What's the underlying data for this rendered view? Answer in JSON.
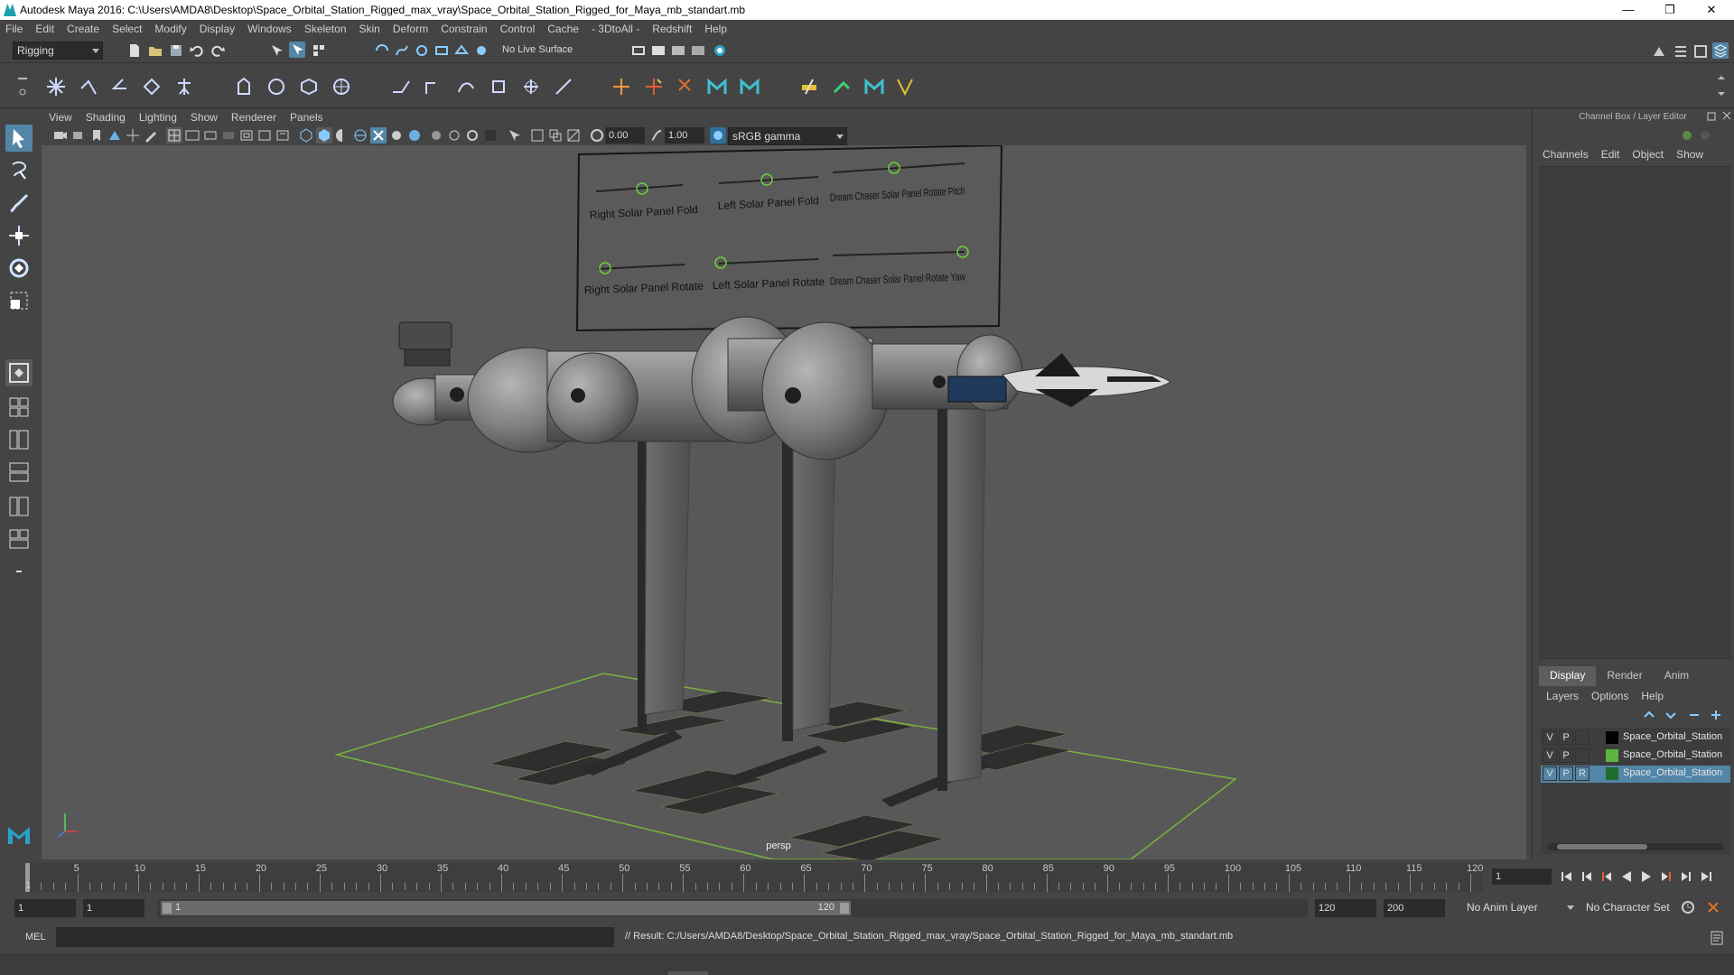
{
  "titlebar": {
    "title": "Autodesk Maya 2016: C:\\Users\\AMDA8\\Desktop\\Space_Orbital_Station_Rigged_max_vray\\Space_Orbital_Station_Rigged_for_Maya_mb_standart.mb"
  },
  "menubar": {
    "items": [
      "File",
      "Edit",
      "Create",
      "Select",
      "Modify",
      "Display",
      "Windows",
      "Skeleton",
      "Skin",
      "Deform",
      "Constrain",
      "Control",
      "Cache",
      "- 3DtoAll -",
      "Redshift",
      "Help"
    ]
  },
  "statusline": {
    "menuset": "Rigging",
    "live_surface": "No Live Surface"
  },
  "viewport": {
    "menu": [
      "View",
      "Shading",
      "Lighting",
      "Show",
      "Renderer",
      "Panels"
    ],
    "exposure": "0.00",
    "gamma": "1.00",
    "color_space": "sRGB gamma",
    "camera_label": "persp",
    "control_board": {
      "labels": [
        "Right Solar Panel Fold",
        "Left Solar Panel Fold",
        "Dream Chaser Solar Panel Rotate Pitch",
        "Right Solar Panel Rotate",
        "Left Solar Panel Rotate",
        "Dream Chaser Solar Panel Rotate Yaw"
      ]
    }
  },
  "channelbox": {
    "title": "Channel Box / Layer Editor",
    "menu": [
      "Channels",
      "Edit",
      "Object",
      "Show"
    ],
    "layer_tabs": [
      "Display",
      "Render",
      "Anim"
    ],
    "layer_menu": [
      "Layers",
      "Options",
      "Help"
    ],
    "layers": [
      {
        "v": "V",
        "p": "P",
        "r": "",
        "name": "Space_Orbital_Station",
        "color": "#000000",
        "selected": false
      },
      {
        "v": "V",
        "p": "P",
        "r": "",
        "name": "Space_Orbital_Station",
        "color": "#5fb340",
        "selected": false
      },
      {
        "v": "V",
        "p": "P",
        "r": "R",
        "name": "Space_Orbital_Station",
        "color": "#1d6e2c",
        "selected": true
      }
    ]
  },
  "timeslider": {
    "ticks": [
      "5",
      "10",
      "15",
      "20",
      "25",
      "30",
      "35",
      "40",
      "45",
      "50",
      "55",
      "60",
      "65",
      "70",
      "75",
      "80",
      "85",
      "90",
      "95",
      "100",
      "105",
      "110",
      "115",
      "120"
    ],
    "start_label": "1",
    "current_frame": "1"
  },
  "rangeslider": {
    "start": "1",
    "playback_start": "1",
    "range_start_label": "1",
    "range_end_label": "120",
    "playback_end": "120",
    "end": "200",
    "anim_layer": "No Anim Layer",
    "char_set": "No Character Set"
  },
  "cmdline": {
    "lang": "MEL",
    "result": "// Result: C:/Users/AMDA8/Desktop/Space_Orbital_Station_Rigged_max_vray/Space_Orbital_Station_Rigged_for_Maya_mb_standart.mb"
  }
}
